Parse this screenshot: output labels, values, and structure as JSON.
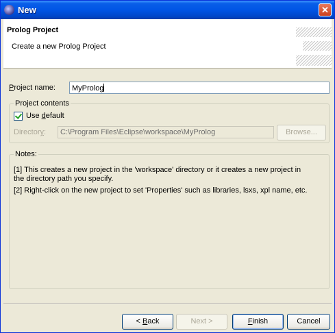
{
  "window": {
    "title": "New",
    "close_glyph": "✕"
  },
  "header": {
    "title": "Prolog Project",
    "description": "Create a new Prolog Project"
  },
  "project_name": {
    "label_prefix": "P",
    "label_rest": "roject name:",
    "value": "MyProlog"
  },
  "project_contents": {
    "legend": "Project contents",
    "use_default_prefix": "Use ",
    "use_default_u": "d",
    "use_default_rest": "efault",
    "use_default_checked": true,
    "directory_label_pre": "Director",
    "directory_label_u": "y",
    "directory_label_post": ":",
    "directory_value": "C:\\Program Files\\Eclipse\\workspace\\MyProlog",
    "browse_label": "Browse..."
  },
  "notes": {
    "legend": "Notes:",
    "line1": "[1] This creates a new project in the 'workspace' directory or it creates a new project in",
    "line2": "the directory path you specify.",
    "line3": "[2] Right-click on the new project to set 'Properties' such as libraries, lsxs, xpl name, etc."
  },
  "buttons": {
    "back_pre": "< ",
    "back_u": "B",
    "back_rest": "ack",
    "next": "Next >",
    "finish_u": "F",
    "finish_rest": "inish",
    "cancel": "Cancel"
  }
}
